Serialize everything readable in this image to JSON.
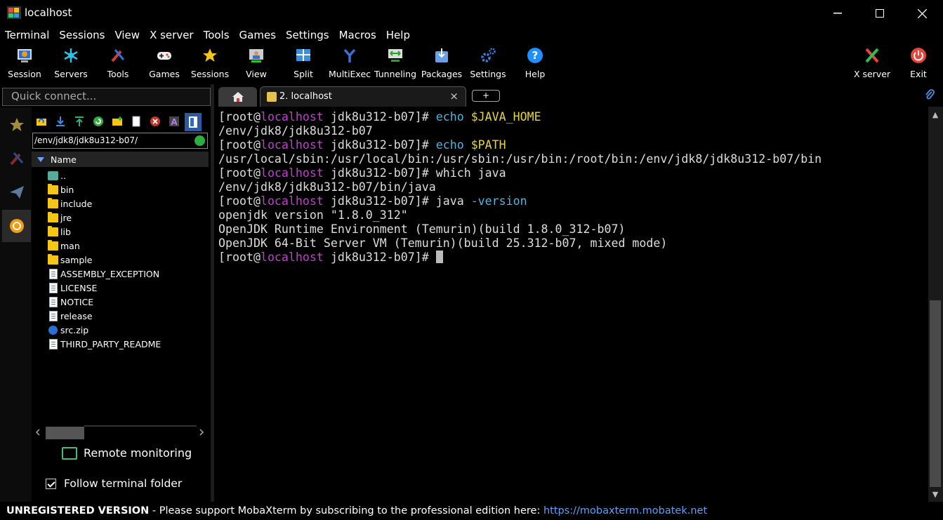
{
  "window": {
    "title": "localhost",
    "controls": [
      "minimize",
      "maximize",
      "close"
    ]
  },
  "menu": [
    "Terminal",
    "Sessions",
    "View",
    "X server",
    "Tools",
    "Games",
    "Settings",
    "Macros",
    "Help"
  ],
  "toolbar": {
    "left": [
      {
        "label": "Session",
        "icon": "session-icon"
      },
      {
        "label": "Servers",
        "icon": "servers-icon"
      },
      {
        "label": "Tools",
        "icon": "tools-icon"
      },
      {
        "label": "Games",
        "icon": "gamepad-icon"
      },
      {
        "label": "Sessions",
        "icon": "star-icon"
      },
      {
        "label": "View",
        "icon": "view-icon"
      },
      {
        "label": "Split",
        "icon": "split-icon"
      },
      {
        "label": "MultiExec",
        "icon": "multiexec-icon"
      },
      {
        "label": "Tunneling",
        "icon": "tunneling-icon"
      },
      {
        "label": "Packages",
        "icon": "packages-icon"
      },
      {
        "label": "Settings",
        "icon": "gears-icon"
      },
      {
        "label": "Help",
        "icon": "help-icon"
      }
    ],
    "right": [
      {
        "label": "X server",
        "icon": "xserver-icon"
      },
      {
        "label": "Exit",
        "icon": "power-icon"
      }
    ]
  },
  "quick_connect": {
    "placeholder": "Quick connect..."
  },
  "sidebar_tabs": [
    "star-icon",
    "tools-icon",
    "send-icon",
    "sftp-icon"
  ],
  "file_browser": {
    "path": "/env/jdk8/jdk8u312-b07/",
    "column": "Name",
    "items": [
      {
        "name": "..",
        "type": "up"
      },
      {
        "name": "bin",
        "type": "folder"
      },
      {
        "name": "include",
        "type": "folder"
      },
      {
        "name": "jre",
        "type": "folder"
      },
      {
        "name": "lib",
        "type": "folder"
      },
      {
        "name": "man",
        "type": "folder"
      },
      {
        "name": "sample",
        "type": "folder"
      },
      {
        "name": "ASSEMBLY_EXCEPTION",
        "type": "file"
      },
      {
        "name": "LICENSE",
        "type": "file"
      },
      {
        "name": "NOTICE",
        "type": "file"
      },
      {
        "name": "release",
        "type": "file"
      },
      {
        "name": "src.zip",
        "type": "zip"
      },
      {
        "name": "THIRD_PARTY_README",
        "type": "file"
      }
    ],
    "remote_monitoring": "Remote monitoring",
    "follow_terminal": {
      "label": "Follow terminal folder",
      "checked": true
    }
  },
  "tabs": {
    "active": "2. localhost",
    "close": "×",
    "new": "+"
  },
  "terminal": {
    "prompt": {
      "user": "[root@",
      "host": "localhost",
      "dir": " jdk8u312-b07]# "
    },
    "lines": [
      {
        "kind": "cmd",
        "parts": [
          {
            "t": "echo ",
            "c": "cmd"
          },
          {
            "t": "$JAVA_HOME",
            "c": "var"
          }
        ]
      },
      {
        "kind": "out",
        "text": "/env/jdk8/jdk8u312-b07"
      },
      {
        "kind": "cmd",
        "parts": [
          {
            "t": "echo ",
            "c": "cmd"
          },
          {
            "t": "$PATH",
            "c": "var"
          }
        ]
      },
      {
        "kind": "out",
        "text": "/usr/local/sbin:/usr/local/bin:/usr/sbin:/usr/bin:/root/bin:/env/jdk8/jdk8u312-b07/bin"
      },
      {
        "kind": "cmd",
        "parts": [
          {
            "t": "which java",
            "c": "plain"
          }
        ]
      },
      {
        "kind": "out",
        "text": "/env/jdk8/jdk8u312-b07/bin/java"
      },
      {
        "kind": "cmd",
        "parts": [
          {
            "t": "java ",
            "c": "plain"
          },
          {
            "t": "-version",
            "c": "opt"
          }
        ]
      },
      {
        "kind": "out",
        "text": "openjdk version \"1.8.0_312\""
      },
      {
        "kind": "out",
        "text": "OpenJDK Runtime Environment (Temurin)(build 1.8.0_312-b07)"
      },
      {
        "kind": "out",
        "text": "OpenJDK 64-Bit Server VM (Temurin)(build 25.312-b07, mixed mode)"
      },
      {
        "kind": "cursor"
      }
    ]
  },
  "status": {
    "registration": "UNREGISTERED VERSION",
    "message": "  -  Please support MobaXterm by subscribing to the professional edition here:  ",
    "link": "https://mobaxterm.mobatek.net"
  }
}
